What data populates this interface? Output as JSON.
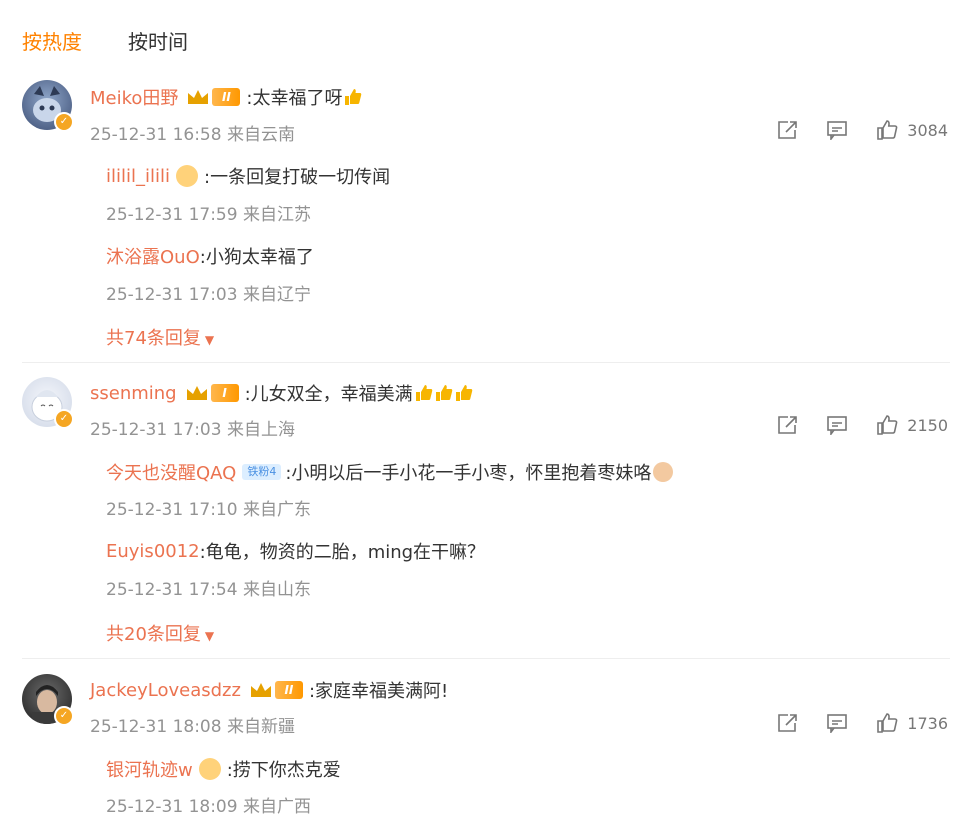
{
  "tabs": [
    {
      "label": "按热度",
      "active": true
    },
    {
      "label": "按时间",
      "active": false
    }
  ],
  "comments": [
    {
      "username": "Meiko田野",
      "rank": "II",
      "text": ":太幸福了呀",
      "meta": "25-12-31 16:58 来自云南",
      "likes": "3084",
      "replies": [
        {
          "username": "ililil_ilili",
          "text": ":一条回复打破一切传闻",
          "meta": "25-12-31 17:59 来自江苏"
        },
        {
          "username": "沐浴露OuO",
          "text": ":小狗太幸福了",
          "meta": "25-12-31 17:03 来自辽宁"
        }
      ],
      "more": "共74条回复"
    },
    {
      "username": "ssenming",
      "rank": "I",
      "text": ":儿女双全，幸福美满",
      "meta": "25-12-31 17:03 来自上海",
      "likes": "2150",
      "replies": [
        {
          "username": "今天也没醒QAQ",
          "level": "铁粉4",
          "text": ":小明以后一手小花一手小枣，怀里抱着枣妹咯",
          "meta": "25-12-31 17:10 来自广东"
        },
        {
          "username": "Euyis0012",
          "text": ":龟龟，物资的二胎，ming在干嘛？",
          "meta": "25-12-31 17:54 来自山东"
        }
      ],
      "more": "共20条回复"
    },
    {
      "username": "JackeyLoveasdzz",
      "rank": "II",
      "text": ":家庭幸福美满阿!",
      "meta": "25-12-31 18:08 来自新疆",
      "likes": "1736",
      "replies": [
        {
          "username": "银河轨迹w",
          "text": ":捞下你杰克爱",
          "meta": "25-12-31 18:09 来自广西"
        }
      ]
    }
  ],
  "colors": {
    "accent": "#ff8200",
    "username": "#eb7350",
    "meta": "#939393",
    "text": "#333333"
  },
  "icons": [
    "share-icon",
    "comment-icon",
    "like-icon",
    "crown-icon",
    "verified-badge-icon",
    "thumbs-up-emoji-icon",
    "dropdown-caret-icon"
  ]
}
